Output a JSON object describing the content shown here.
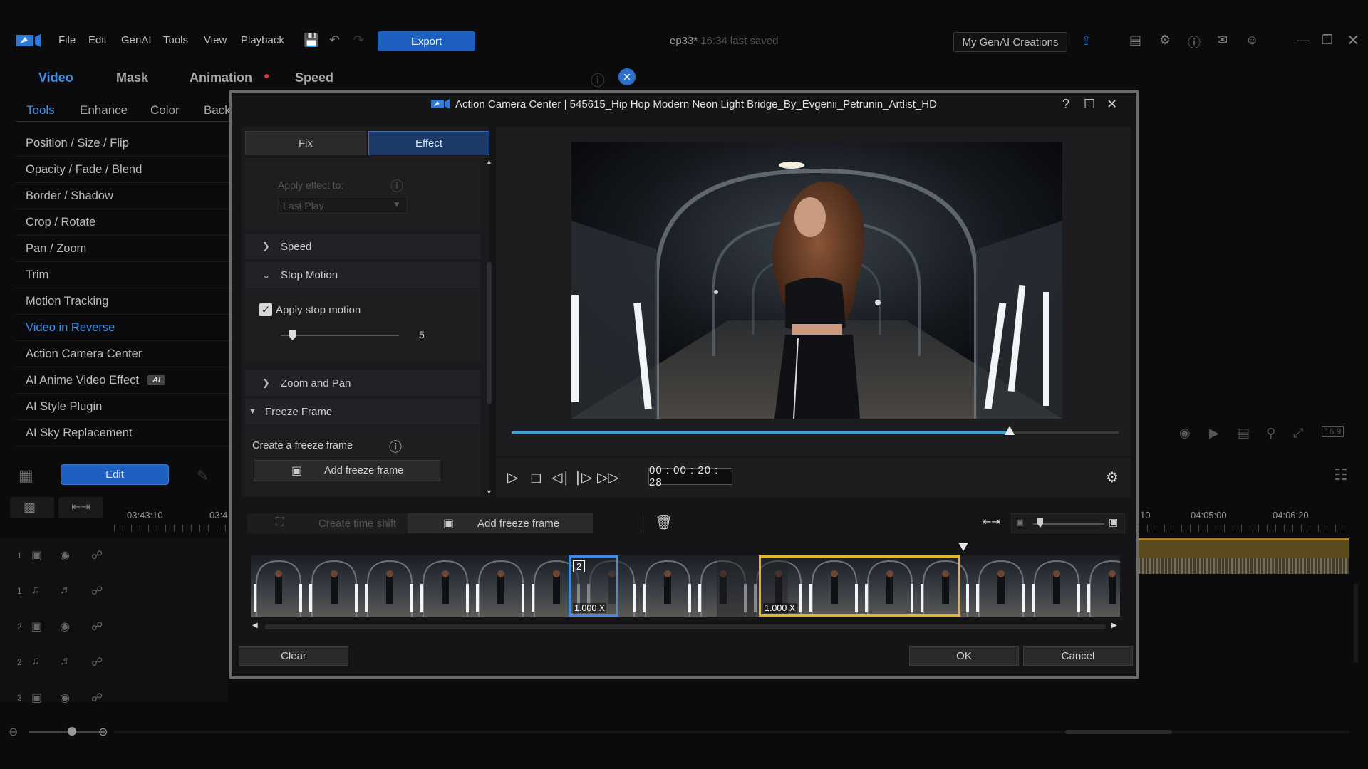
{
  "app": {
    "menu": [
      "File",
      "Edit",
      "GenAI",
      "Tools",
      "View",
      "Playback"
    ],
    "export_label": "Export",
    "doc_name": "ep33*",
    "doc_saved": "16:34 last saved",
    "genai_label": "My GenAI Creations"
  },
  "left": {
    "tabs": [
      "Video",
      "Mask",
      "Animation",
      "Speed"
    ],
    "subtabs": [
      "Tools",
      "Enhance",
      "Color",
      "Back"
    ],
    "tools": [
      "Position / Size / Flip",
      "Opacity / Fade / Blend",
      "Border / Shadow",
      "Crop / Rotate",
      "Pan / Zoom",
      "Trim",
      "Motion Tracking",
      "Video in Reverse",
      "Action Camera Center",
      "AI Anime Video Effect",
      "AI Style Plugin",
      "AI Sky Replacement"
    ],
    "ai_badge": "AI",
    "edit_label": "Edit"
  },
  "timeline": {
    "times": [
      "03:43:10",
      "03:4",
      "10",
      "04:05:00",
      "04:06:20"
    ],
    "tracks": [
      "1",
      "1",
      "2",
      "2",
      "3"
    ]
  },
  "dialog": {
    "title": "Action Camera Center  |  545615_Hip Hop Modern Neon Light Bridge_By_Evgenii_Petrunin_Artlist_HD",
    "tabs": {
      "fix": "Fix",
      "effect": "Effect"
    },
    "apply_effect_to": "Apply effect to:",
    "apply_effect_value": "Last Play",
    "sections": {
      "speed": "Speed",
      "stop_motion": "Stop Motion",
      "zoom_pan": "Zoom and Pan",
      "freeze_frame": "Freeze Frame"
    },
    "apply_stop_motion": "Apply stop motion",
    "stop_motion_checked": true,
    "stop_motion_value": "5",
    "stop_motion_level": 0.1,
    "create_freeze": "Create a freeze frame",
    "add_freeze": "Add freeze frame",
    "timecode": "00 : 00 : 20 : 28",
    "playback_progress": 0.82,
    "create_time_shift": "Create time shift",
    "add_freeze_toolbar": "Add freeze frame",
    "speed_badges": [
      "1.000 X",
      "1.000 X"
    ],
    "shift_count": "2",
    "clear_label": "Clear",
    "ok_label": "OK",
    "cancel_label": "Cancel",
    "colors": {
      "accent": "#1f5fbf",
      "effect_tab": "#1c3a68",
      "selected_frame": "#3a8ce6",
      "freeze_segment": "#e8b41f",
      "progress": "#3aa3d8"
    }
  }
}
